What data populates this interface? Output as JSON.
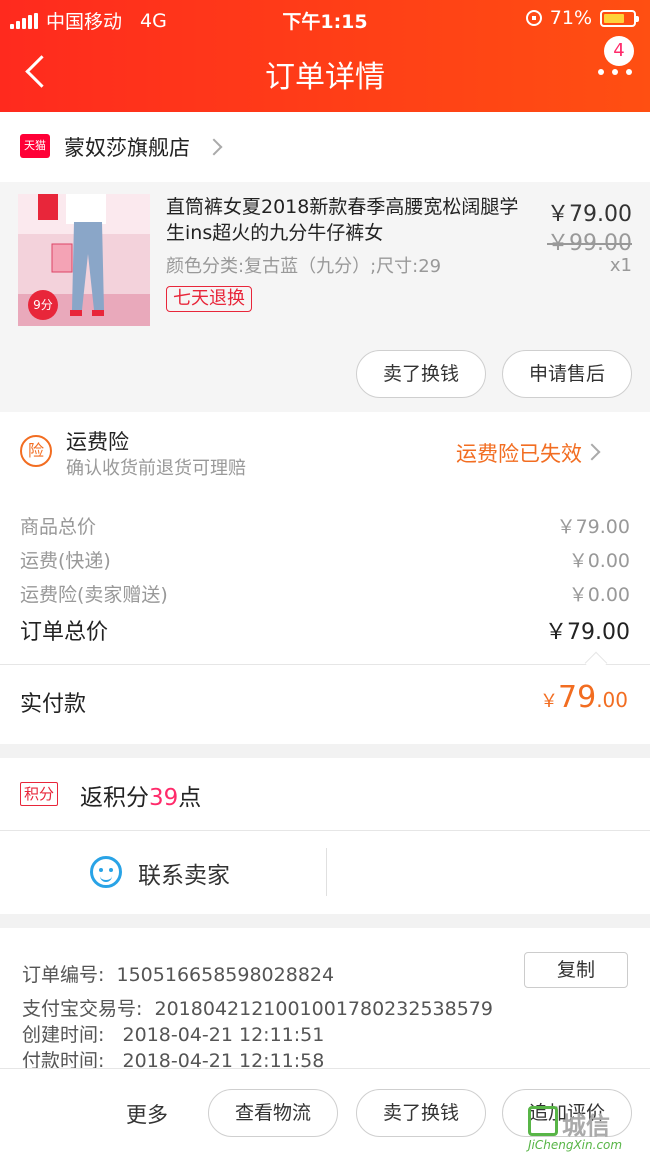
{
  "status_bar": {
    "carrier": "中国移动",
    "network": "4G",
    "time": "下午1:15",
    "battery": "71%",
    "battery_level": 0.71
  },
  "header": {
    "title": "订单详情",
    "badge_count": "4",
    "brand_color": "#ff3319"
  },
  "shop": {
    "platform_badge": "天猫",
    "name": "蒙奴莎旗舰店"
  },
  "product": {
    "title": "直筒裤女夏2018新款春季高腰宽松阔腿学生ins超火的九分牛仔裤女",
    "thumb_tag": "9分",
    "price": "￥79.00",
    "original_price": "￥99.00",
    "quantity": "x1",
    "sku": "颜色分类:复古蓝（九分）;尺寸:29",
    "return_policy": "七天退换",
    "actions": {
      "sell": "卖了换钱",
      "after_sale": "申请售后"
    }
  },
  "insurance": {
    "icon_text": "险",
    "title": "运费险",
    "subtitle": "确认收货前退货可理赔",
    "status": "运费险已失效",
    "accent_color": "#f26d21"
  },
  "summary": {
    "items": [
      {
        "label": "商品总价",
        "value": "￥79.00"
      },
      {
        "label": "运费(快递)",
        "value": "￥0.00"
      },
      {
        "label": "运费险(卖家赠送)",
        "value": "￥0.00"
      }
    ],
    "total_label": "订单总价",
    "total_value": "￥79.00",
    "paid_label": "实付款",
    "paid_currency": "￥",
    "paid_int": "79",
    "paid_dec": ".00"
  },
  "points": {
    "badge": "积分",
    "prefix": "返积分",
    "number": "39",
    "suffix": "点"
  },
  "contact": {
    "label": "联系卖家"
  },
  "order_info": {
    "order_no_label": "订单编号:",
    "order_no": "150516658598028824",
    "copy": "复制",
    "alipay_label": "支付宝交易号:",
    "alipay_no": "2018042121001001780232538579",
    "created_label": "创建时间:",
    "created": "2018-04-21 12:11:51",
    "paid_label": "付款时间:",
    "paid": "2018-04-21 12:11:58"
  },
  "bottom_bar": {
    "more": "更多",
    "logistics": "查看物流",
    "sell": "卖了换钱",
    "review": "追加评价"
  },
  "watermark": {
    "text": "城信",
    "sub": "JiChengXin.com"
  }
}
